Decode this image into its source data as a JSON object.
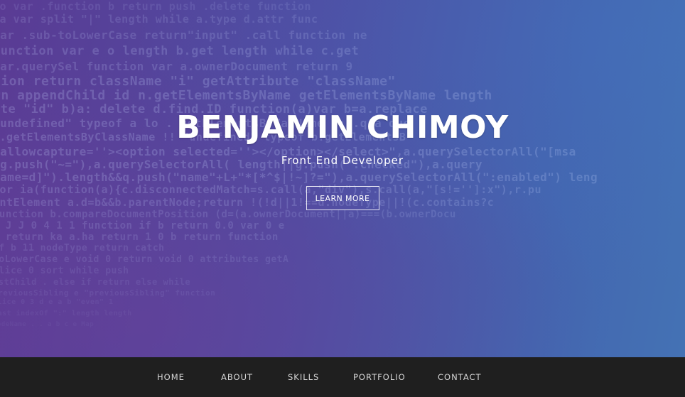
{
  "hero": {
    "title": "BENJAMIN CHIMOY",
    "subtitle": "Front End Developer",
    "cta_label": "LEARN MORE"
  },
  "nav": {
    "items": [
      {
        "label": "HOME"
      },
      {
        "label": "ABOUT"
      },
      {
        "label": "SKILLS"
      },
      {
        "label": "PORTFOLIO"
      },
      {
        "label": "CONTACT"
      }
    ]
  },
  "colors": {
    "hero_gradient_start": "#5a3b94",
    "hero_gradient_end": "#4472b4",
    "navbar_bg": "#1f1f1f",
    "text": "#ffffff"
  }
}
